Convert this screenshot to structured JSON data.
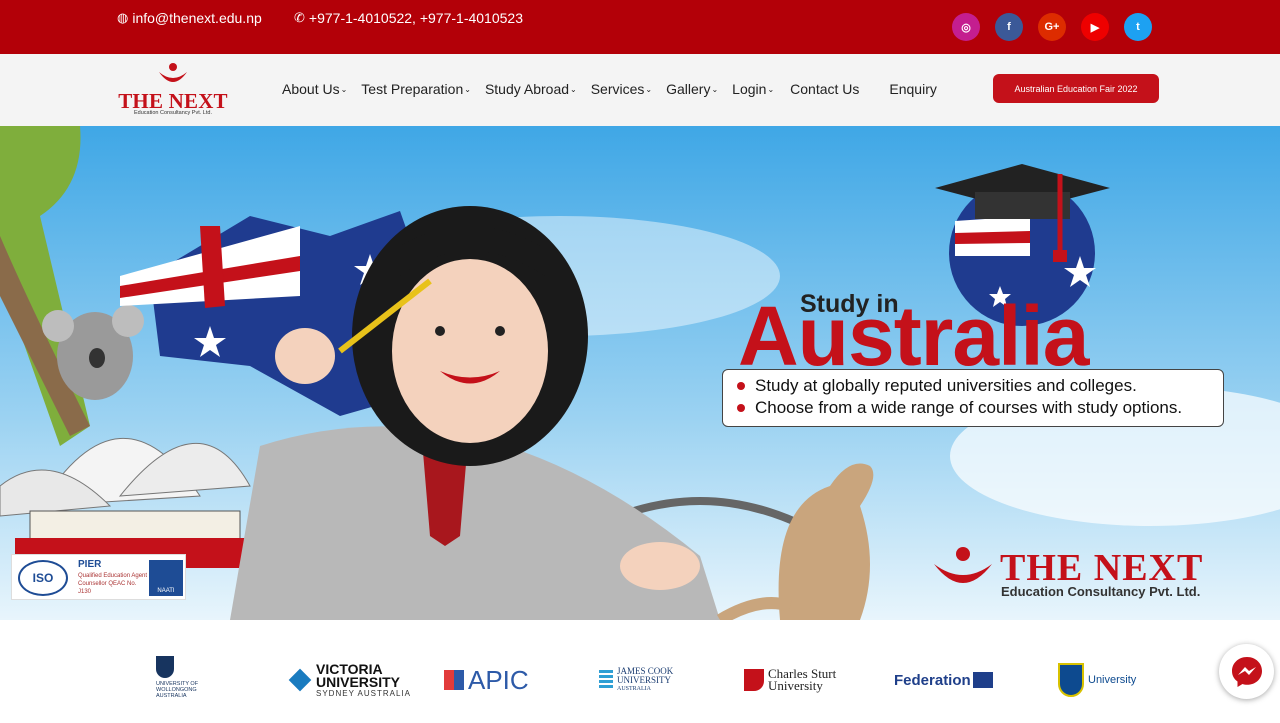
{
  "topbar": {
    "email": "info@thenext.edu.np",
    "phone": "+977-1-4010522, +977-1-4010523",
    "socials": [
      {
        "name": "instagram",
        "glyph": "◎",
        "color": "#c41e8f"
      },
      {
        "name": "facebook",
        "glyph": "f",
        "color": "#3b5998"
      },
      {
        "name": "google-plus",
        "glyph": "G+",
        "color": "#dd2c00"
      },
      {
        "name": "youtube",
        "glyph": "▶",
        "color": "#e00"
      },
      {
        "name": "twitter",
        "glyph": "t",
        "color": "#1da1f2"
      }
    ]
  },
  "logo": {
    "name": "THE NEXT",
    "subtitle": "Education Consultancy Pvt. Ltd."
  },
  "nav": {
    "items": [
      {
        "label": "About Us",
        "dropdown": true
      },
      {
        "label": "Test Preparation",
        "dropdown": true
      },
      {
        "label": "Study Abroad",
        "dropdown": true
      },
      {
        "label": "Services",
        "dropdown": true
      },
      {
        "label": "Gallery",
        "dropdown": true
      },
      {
        "label": "Login",
        "dropdown": true
      },
      {
        "label": "Contact Us",
        "dropdown": false
      },
      {
        "label": "Enquiry",
        "dropdown": false
      }
    ],
    "cta": "Australian Education Fair 2022"
  },
  "hero": {
    "study_in": "Study in",
    "country": "Australia",
    "bullets": [
      "Study at globally reputed universities and colleges.",
      "Choose from a wide range of courses with study options."
    ],
    "brand_name": "THE NEXT",
    "brand_sub": "Education Consultancy Pvt. Ltd.",
    "cert": {
      "iso": "ISO",
      "pier": "PIER",
      "qea": "Qualified Education Agent Counsellor QEAC No. J130",
      "naati": "NAATI"
    }
  },
  "partners": {
    "uow": "UNIVERSITY OF WOLLONGONG AUSTRALIA",
    "vu_1": "VICTORIA",
    "vu_2": "UNIVERSITY",
    "vu_3": "SYDNEY AUSTRALIA",
    "apic": "APIC",
    "jcu_1": "JAMES COOK",
    "jcu_2": "UNIVERSITY",
    "jcu_3": "AUSTRALIA",
    "csu_1": "Charles Sturt",
    "csu_2": "University",
    "fed": "Federation",
    "cqu": "University"
  },
  "colors": {
    "brand_red": "#c4111a",
    "topbar_red": "#b30008"
  }
}
